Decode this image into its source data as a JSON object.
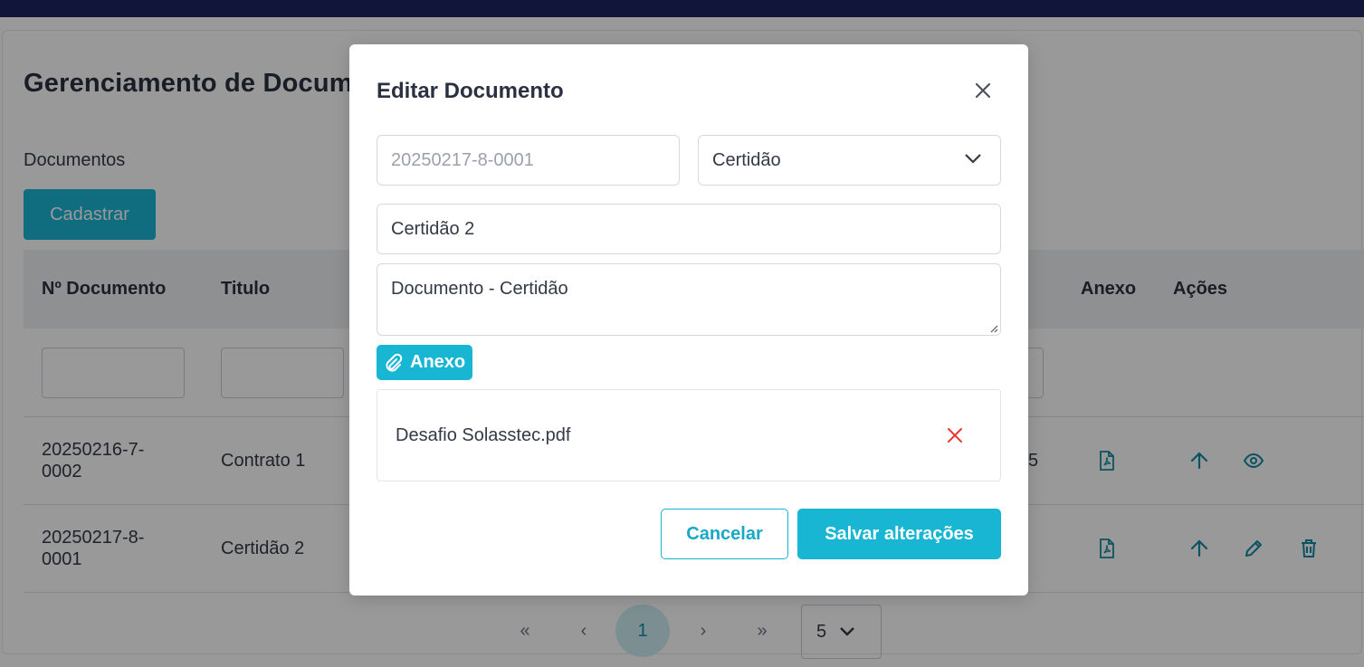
{
  "page": {
    "title": "Gerenciamento de Documentos",
    "section_label": "Documentos",
    "register_button": "Cadastrar"
  },
  "table": {
    "headers": {
      "number": "Nº Documento",
      "title": "Titulo",
      "attachment": "Anexo",
      "actions": "Ações"
    },
    "rows": [
      {
        "number_line1": "20250216-7-",
        "number_line2": "0002",
        "title": "Contrato 1",
        "partial": "5"
      },
      {
        "number_line1": "20250217-8-",
        "number_line2": "0001",
        "title": "Certidão 2",
        "partial": ""
      }
    ]
  },
  "pagination": {
    "first": "«",
    "prev": "‹",
    "current": "1",
    "next": "›",
    "last": "»",
    "page_size": "5"
  },
  "modal": {
    "title": "Editar Documento",
    "document_number": "20250217-8-0001",
    "document_type": "Certidão",
    "document_title": "Certidão 2",
    "description": "Documento - Certidão",
    "attach_button": "Anexo",
    "attachment_file": "Desafio Solasstec.pdf",
    "cancel_button": "Cancelar",
    "save_button": "Salvar alterações"
  },
  "colors": {
    "accent": "#19b6d4",
    "topbar": "#1b2460",
    "danger": "#e53935",
    "icon": "#118aa3"
  }
}
